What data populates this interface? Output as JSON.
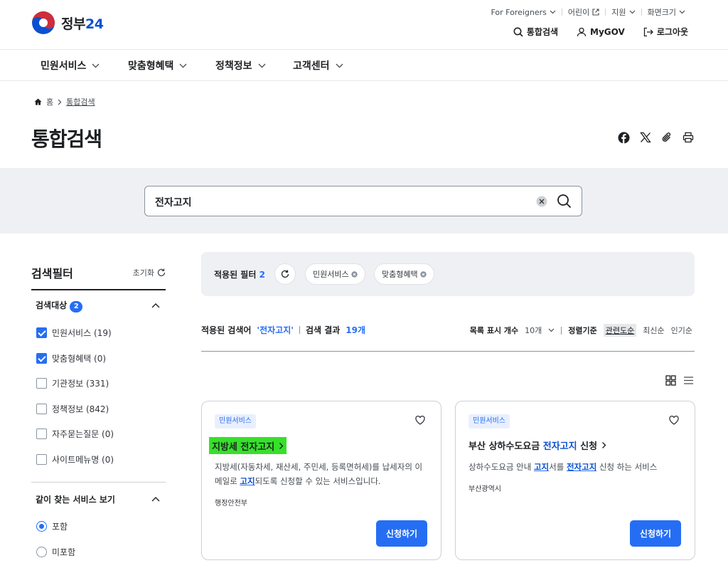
{
  "header": {
    "logo_text": "정부",
    "logo_num": "24",
    "util": [
      {
        "label": "For Foreigners"
      },
      {
        "label": "어린이"
      },
      {
        "label": "지원"
      },
      {
        "label": "화면크기"
      }
    ],
    "quick": {
      "search": "통합검색",
      "mygov": "MyGOV",
      "logout": "로그아웃"
    }
  },
  "gnb": {
    "items": [
      "민원서비스",
      "맞춤형혜택",
      "정책정보",
      "고객센터"
    ]
  },
  "breadcrumb": {
    "home": "홈",
    "current": "통합검색"
  },
  "page_title": "통합검색",
  "search": {
    "value": "전자고지"
  },
  "filter": {
    "title": "검색필터",
    "reset": "초기화",
    "target_group": {
      "title": "검색대상",
      "count": "2",
      "options": [
        {
          "label": "민원서비스 (19)",
          "checked": true
        },
        {
          "label": "맞춤형혜택 (0)",
          "checked": true
        },
        {
          "label": "기관정보 (331)",
          "checked": false
        },
        {
          "label": "정책정보 (842)",
          "checked": false
        },
        {
          "label": "자주묻는질문 (0)",
          "checked": false
        },
        {
          "label": "사이트메뉴명 (0)",
          "checked": false
        }
      ]
    },
    "together_group": {
      "title": "같이 찾는 서비스 보기",
      "options": [
        {
          "label": "포함",
          "selected": true
        },
        {
          "label": "미포함",
          "selected": false
        }
      ]
    }
  },
  "applied": {
    "label": "적용된 필터",
    "count": "2",
    "chips": [
      "민원서비스",
      "맞춤형혜택"
    ]
  },
  "results": {
    "keyword_label": "적용된 검색어",
    "keyword": "'전자고지'",
    "count_label": "검색 결과",
    "count": "19개",
    "page_size_label": "목록 표시 개수",
    "page_size": "10개",
    "sort_label": "정렬기준",
    "sorts": [
      "관련도순",
      "최신순",
      "인기순"
    ]
  },
  "cards": [
    {
      "tag": "민원서비스",
      "title_pre": "지방세 ",
      "title_kw": "전자고지",
      "title_post": "",
      "desc_1": "지방세(자동차세, 재산세, 주민세, 등록면허세)를 납세자의 이메일로 ",
      "desc_kw": "고지",
      "desc_2": "되도록 신청할 수 있는 서비스입니다.",
      "org": "행정안전부",
      "button": "신청하기"
    },
    {
      "tag": "민원서비스",
      "title_pre": "부산 상하수도요금 ",
      "title_kw": "전자고지",
      "title_post": " 신청",
      "desc_1": "상하수도요금 안내 ",
      "desc_kw": "고지",
      "desc_2": "서를 ",
      "desc_kw2": "전자고지",
      "desc_3": " 신청 하는 서비스",
      "org": "부산광역시",
      "button": "신청하기"
    }
  ],
  "colors": {
    "primary": "#256ef4",
    "highlight": "#36e12a",
    "band": "#eef0f4"
  }
}
